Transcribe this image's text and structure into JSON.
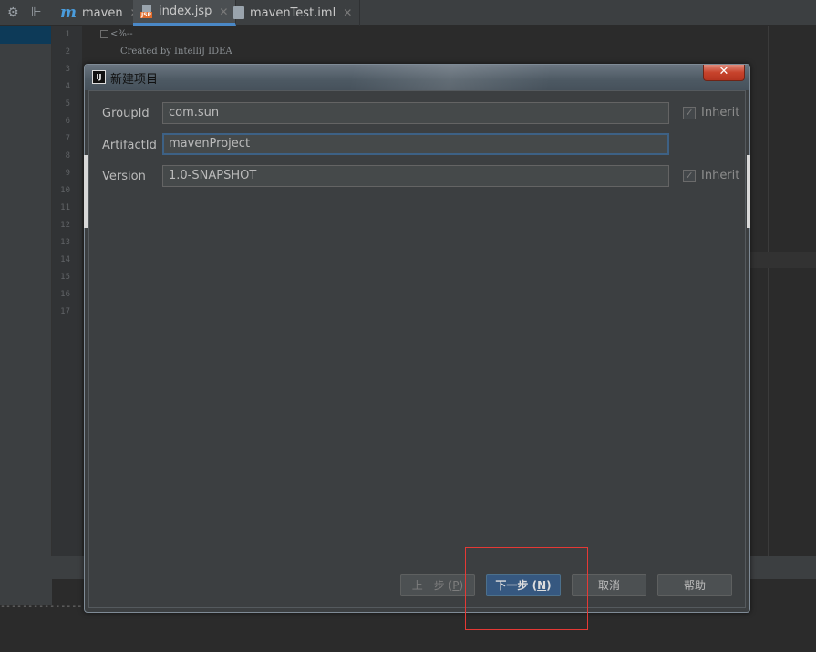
{
  "ide": {
    "tabs": [
      {
        "label": "maven",
        "icon": "maven-m-icon"
      },
      {
        "label": "index.jsp",
        "icon": "jsp-file-icon",
        "active": true
      },
      {
        "label": "mavenTest.iml",
        "icon": "iml-file-icon"
      }
    ],
    "line_numbers": [
      "1",
      "2",
      "3",
      "4",
      "5",
      "6",
      "7",
      "8",
      "9",
      "10",
      "11",
      "12",
      "13",
      "14",
      "15",
      "16",
      "17"
    ],
    "code_line1": "<%--",
    "code_line2": "Created by IntelliJ IDEA",
    "console_dashes": "----------------"
  },
  "dialog": {
    "title": "新建项目",
    "app_icon_text": "IJ",
    "close_glyph": "✕",
    "fields": {
      "groupId": {
        "label": "GroupId",
        "value": "com.sun"
      },
      "artifactId": {
        "label": "ArtifactId",
        "value": "mavenProject"
      },
      "version": {
        "label": "Version",
        "value": "1.0-SNAPSHOT"
      }
    },
    "inherit_label": "Inherit",
    "buttons": {
      "previous": {
        "text": "上一步 (",
        "mnemonic": "P",
        "end": ")"
      },
      "next": {
        "text": "下一步 (",
        "mnemonic": "N",
        "end": ")"
      },
      "cancel": "取消",
      "help": "帮助"
    }
  },
  "colors": {
    "accent": "#365880",
    "highlight_box": "#e53935",
    "active_tab_underline": "#4a88c7"
  }
}
